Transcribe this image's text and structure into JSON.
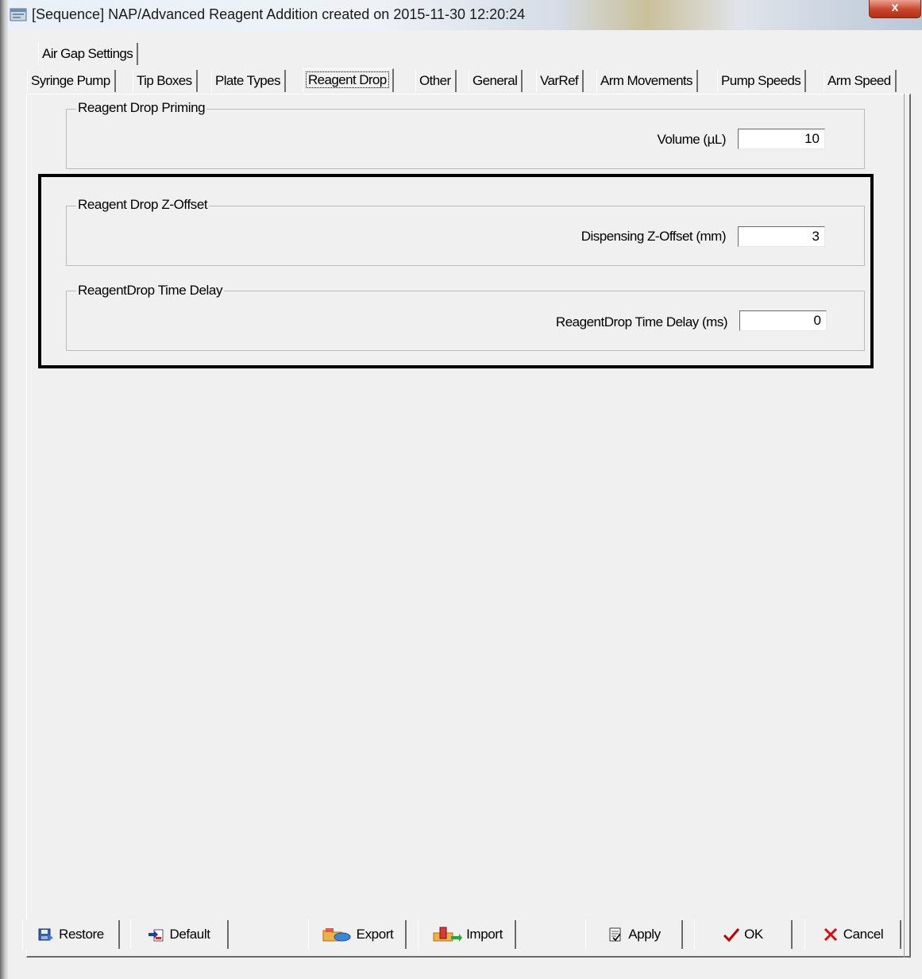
{
  "window": {
    "title": "[Sequence] NAP/Advanced Reagent Addition created on 2015-11-30 12:20:24",
    "close_label": "x"
  },
  "tabs": {
    "row_top": [
      {
        "label": "Air Gap Settings"
      }
    ],
    "row_bottom": [
      {
        "label": "Syringe Pump"
      },
      {
        "label": "Tip Boxes"
      },
      {
        "label": "Plate Types"
      },
      {
        "label": "Reagent Drop",
        "active": true
      },
      {
        "label": "Other"
      },
      {
        "label": "General"
      },
      {
        "label": "VarRef"
      },
      {
        "label": "Arm Movements"
      },
      {
        "label": "Pump Speeds"
      },
      {
        "label": "Arm Speed"
      }
    ]
  },
  "groups": {
    "priming": {
      "title": "Reagent Drop Priming",
      "field_label": "Volume (µL)",
      "field_value": "10"
    },
    "z_offset": {
      "title": "Reagent Drop Z-Offset",
      "field_label": "Dispensing Z-Offset (mm)",
      "field_value": "3"
    },
    "time_delay": {
      "title": "ReagentDrop Time Delay",
      "field_label": "ReagentDrop Time Delay (ms)",
      "field_value": "0"
    }
  },
  "buttons": {
    "restore": "Restore",
    "default": "Default",
    "export": "Export",
    "import": "Import",
    "apply": "Apply",
    "ok": "OK",
    "cancel": "Cancel"
  },
  "icons": {
    "window": "window-app-icon",
    "restore": "restore-disk-icon",
    "default": "default-arrow-doc-icon",
    "export": "export-folder-icon",
    "import": "import-folder-icon",
    "apply": "apply-doc-icon",
    "ok": "checkmark-icon",
    "cancel": "x-icon"
  },
  "colors": {
    "ok_check": "#c00000",
    "cancel_x": "#cc1010",
    "highlight_frame": "#000000"
  }
}
